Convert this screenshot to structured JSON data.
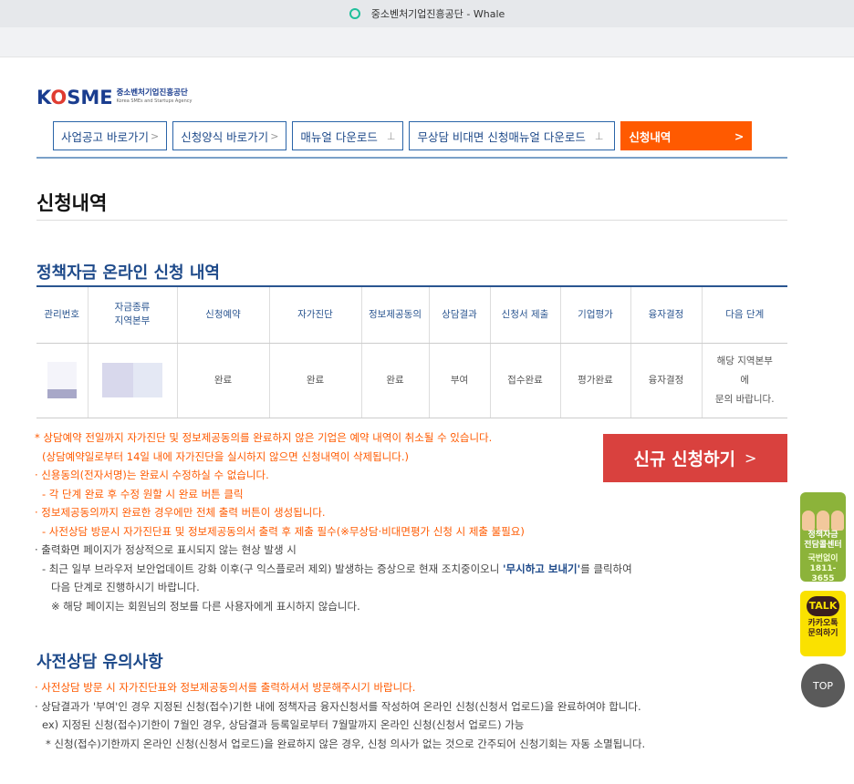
{
  "window": {
    "title": "중소벤처기업진흥공단 - Whale"
  },
  "logo": {
    "word_k": "K",
    "word_o": "O",
    "word_rest": "SME",
    "korean": "중소벤처기업진흥공단",
    "english": "Korea SMEs and Startups Agency"
  },
  "nav": [
    {
      "label": "사업공고 바로가기",
      "icon": ">"
    },
    {
      "label": "신청양식 바로가기",
      "icon": ">"
    },
    {
      "label": "매뉴얼 다운로드",
      "icon": "⊥"
    },
    {
      "label": "무상담 비대면 신청매뉴얼 다운로드",
      "icon": "⊥"
    },
    {
      "label": "신청내역",
      "icon": ">"
    }
  ],
  "page_title": "신청내역",
  "section1_title": "정책자금 온라인 신청 내역",
  "table": {
    "headers": [
      "관리번호",
      "자금종류\n지역본부",
      "신청예약",
      "자가진단",
      "정보제공동의",
      "상담결과",
      "신청서 제출",
      "기업평가",
      "융자결정",
      "다음 단계"
    ],
    "row": [
      "",
      "",
      "완료",
      "완료",
      "완료",
      "부여",
      "접수완료",
      "평가완료",
      "융자결정",
      "해당 지역본부\n에\n문의 바랍니다."
    ]
  },
  "notes": [
    "* 상담예약 전일까지 자가진단 및 정보제공동의를 완료하지 않은 기업은 예약 내역이 취소될 수 있습니다.",
    "(상담예약일로부터 14일 내에 자가진단을 실시하지 않으면 신청내역이 삭제됩니다.)",
    "· 신용동의(전자서명)는 완료시 수정하실 수 없습니다.",
    "- 각 단계 완료 후 수정 원할 시 완료 버튼 클릭",
    "· 정보제공동의까지 완료한 경우에만 전체 출력 버튼이 생성됩니다.",
    "- 사전상담 방문시 자가진단표 및 정보제공동의서 출력 후 제출 필수(※무상담·비대면평가 신청 시 제출 불필요)",
    "· 출력화면 페이지가 정상적으로 표시되지 않는 현상 발생 시",
    "- 최근 일부 브라우저 보안업데이트 강화 이후(구 익스플로러 제외) 발생하는 증상으로 현재 조치중이오니",
    "'무시하고 보내기'",
    "를 클릭하여",
    "다음 단계로 진행하시기 바랍니다.",
    "※ 해당 페이지는 회원님의 정보를 다른 사용자에게 표시하지 않습니다."
  ],
  "new_button": {
    "label": "신규 신청하기",
    "icon": ">"
  },
  "section2_title": "사전상담 유의사항",
  "notes2": [
    "· 사전상담 방문 시 자가진단표와 정보제공동의서를 출력하셔서 방문해주시기 바랍니다.",
    "· 상담결과가 '부여'인 경우 지정된 신청(접수)기한 내에 정책자금 융자신청서를 작성하여 온라인 신청(신청서 업로드)을 완료하여야 합니다.",
    "ex) 지정된 신청(접수)기한이 7월인 경우, 상담결과 등록일로부터 7월말까지 온라인 신청(신청서 업로드) 가능",
    "* 신청(접수)기한까지 온라인 신청(신청서 업로드)을 완료하지 않은 경우, 신청 의사가 없는 것으로 간주되어 신청기회는 자동 소멸됩니다."
  ],
  "float_consult": {
    "line1": "정책자금",
    "line2": "전담콜센터",
    "phone_label": "국번없이",
    "phone": "1811-3655"
  },
  "float_kakao": {
    "badge": "TALK",
    "line1": "카카오톡",
    "line2": "문의하기"
  },
  "top_button": {
    "label": "TOP"
  },
  "colors": {
    "brand_blue": "#1e4a8a",
    "accent_orange": "#ff5a00",
    "new_button_red": "#d9413e",
    "kakao_yellow": "#fae100",
    "consult_green": "#8cb33a"
  }
}
